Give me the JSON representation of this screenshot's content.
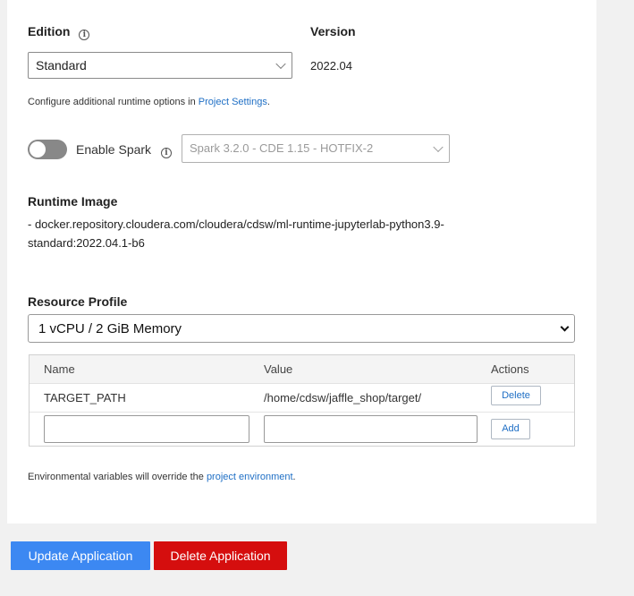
{
  "edition": {
    "label": "Edition",
    "info_icon": "info-icon",
    "selected": "Standard"
  },
  "version": {
    "label": "Version",
    "value": "2022.04"
  },
  "runtime_hint": {
    "prefix": "Configure additional runtime options in ",
    "link": "Project Settings",
    "suffix": "."
  },
  "spark": {
    "toggle_on": false,
    "label": "Enable Spark",
    "info_icon": "info-icon",
    "selected": "Spark 3.2.0 - CDE 1.15 - HOTFIX-2"
  },
  "runtime_image": {
    "label": "Runtime Image",
    "line1": "- docker.repository.cloudera.com/cloudera/cdsw/ml-runtime-jupyterlab-python3.9-",
    "line2": "standard:2022.04.1-b6"
  },
  "resource_profile": {
    "label": "Resource Profile",
    "selected": "1 vCPU / 2 GiB Memory"
  },
  "env_table": {
    "headers": [
      "Name",
      "Value",
      "Actions"
    ],
    "rows": [
      {
        "name": "TARGET_PATH",
        "value": "/home/cdsw/jaffle_shop/target/",
        "action": "Delete"
      }
    ],
    "new_row": {
      "name": "",
      "value": "",
      "action": "Add"
    }
  },
  "env_hint": {
    "prefix": "Environmental variables will override the ",
    "link": "project environment",
    "suffix": "."
  },
  "buttons": {
    "update": "Update Application",
    "delete": "Delete Application"
  },
  "colors": {
    "link": "#1f6fc5",
    "primary_button": "#3c88f2",
    "danger_button": "#d50e0e",
    "toggle_off": "#888888"
  }
}
